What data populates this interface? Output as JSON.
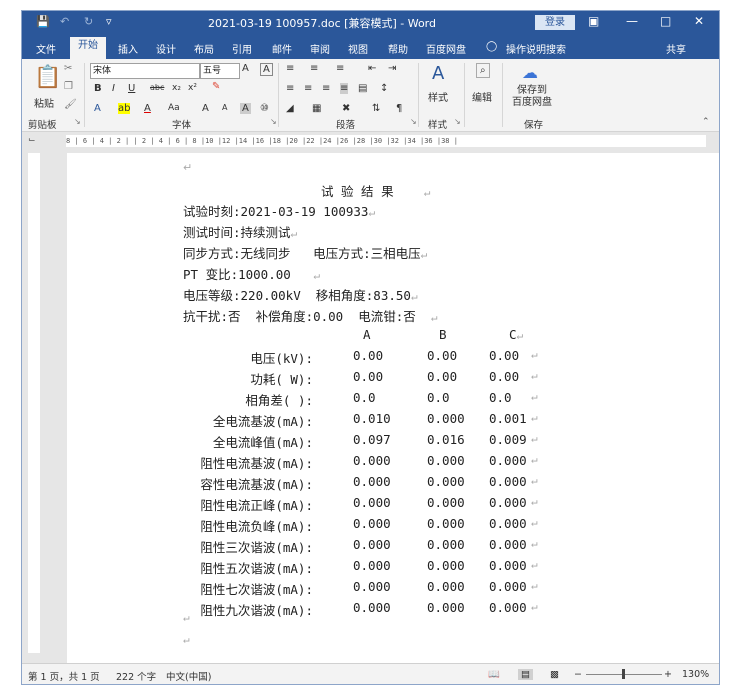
{
  "titlebar": {
    "filename": "2021-03-19 100957.doc [兼容模式] - Word",
    "login": "登录"
  },
  "tabs": [
    "文件",
    "开始",
    "插入",
    "设计",
    "布局",
    "引用",
    "邮件",
    "审阅",
    "视图",
    "帮助",
    "百度网盘",
    "操作说明搜索",
    "共享"
  ],
  "ribbon": {
    "paste": "粘贴",
    "font_name": "宋体",
    "font_size": "五号",
    "style": "样式",
    "edit": "编辑",
    "baidu": "保存到\n百度网盘",
    "groups": [
      "剪贴板",
      "字体",
      "段落",
      "样式",
      "保存"
    ]
  },
  "document": {
    "title": "试 验 结 果",
    "lines": [
      "试验时刻:2021-03-19 100933",
      "测试时间:持续测试",
      "同步方式:无线同步   电压方式:三相电压",
      "PT 变比:1000.00",
      "电压等级:220.00kV  移相角度:83.50",
      "抗干扰:否  补偿角度:0.00  电流钳:否"
    ],
    "table_header": [
      "A",
      "B",
      "C"
    ],
    "table_rows": [
      {
        "label": "电压(kV):",
        "a": "0.00",
        "b": "0.00",
        "c": "0.00"
      },
      {
        "label": "功耗( W):",
        "a": "0.00",
        "b": "0.00",
        "c": "0.00"
      },
      {
        "label": "相角差( ):",
        "a": "0.0",
        "b": "0.0",
        "c": "0.0"
      },
      {
        "label": "全电流基波(mA):",
        "a": "0.010",
        "b": "0.000",
        "c": "0.001"
      },
      {
        "label": "全电流峰值(mA):",
        "a": "0.097",
        "b": "0.016",
        "c": "0.009"
      },
      {
        "label": "阻性电流基波(mA):",
        "a": "0.000",
        "b": "0.000",
        "c": "0.000"
      },
      {
        "label": "容性电流基波(mA):",
        "a": "0.000",
        "b": "0.000",
        "c": "0.000"
      },
      {
        "label": "阻性电流正峰(mA):",
        "a": "0.000",
        "b": "0.000",
        "c": "0.000"
      },
      {
        "label": "阻性电流负峰(mA):",
        "a": "0.000",
        "b": "0.000",
        "c": "0.000"
      },
      {
        "label": "阻性三次谐波(mA):",
        "a": "0.000",
        "b": "0.000",
        "c": "0.000"
      },
      {
        "label": "阻性五次谐波(mA):",
        "a": "0.000",
        "b": "0.000",
        "c": "0.000"
      },
      {
        "label": "阻性七次谐波(mA):",
        "a": "0.000",
        "b": "0.000",
        "c": "0.000"
      },
      {
        "label": "阻性九次谐波(mA):",
        "a": "0.000",
        "b": "0.000",
        "c": "0.000"
      }
    ]
  },
  "status": {
    "page": "第 1 页，共 1 页",
    "words": "222 个字",
    "lang": "中文(中国)",
    "zoom": "130%"
  }
}
